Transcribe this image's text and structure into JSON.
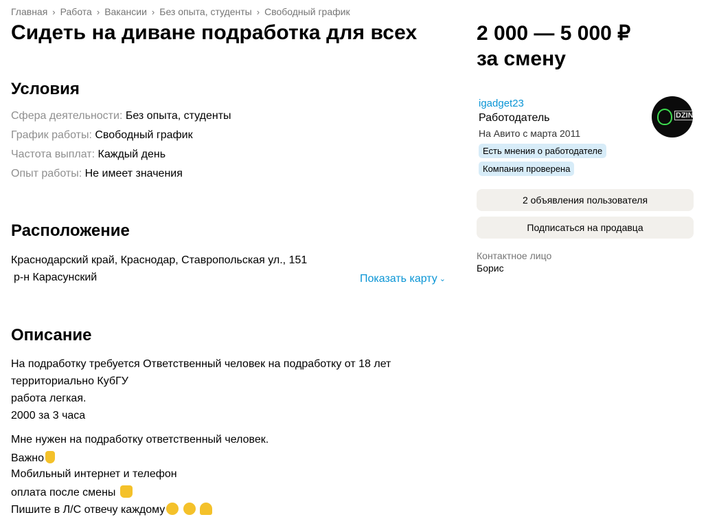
{
  "breadcrumbs": [
    "Главная",
    "Работа",
    "Вакансии",
    "Без опыта, студенты",
    "Свободный график"
  ],
  "title": "Сидеть на диване подработка для всех",
  "price": {
    "range": "2 000 — 5 000 ₽",
    "period": "за смену"
  },
  "conditions": {
    "heading": "Условия",
    "items": [
      {
        "label": "Сфера деятельности:",
        "value": "Без опыта, студенты"
      },
      {
        "label": "График работы:",
        "value": "Свободный график"
      },
      {
        "label": "Частота выплат:",
        "value": "Каждый день"
      },
      {
        "label": "Опыт работы:",
        "value": "Не имеет значения"
      }
    ]
  },
  "location": {
    "heading": "Расположение",
    "address": "Краснодарский край, Краснодар, Ставропольская ул., 151",
    "district": "р-н Карасунский",
    "show_map": "Показать карту"
  },
  "description": {
    "heading": "Описание",
    "lines": [
      "На подработку требуется Ответственный человек на подработку от 18 лет",
      "территориально КубГУ",
      "работа легкая.",
      "2000 за 3 часа",
      "Мне нужен на подработку ответственный человек.",
      "Важно",
      "Мобильный интернет и телефон",
      "оплата после смены",
      "Пишите в Л/С отвечу каждому"
    ]
  },
  "seller": {
    "name": "igadget23",
    "role": "Работодатель",
    "since": "На Авито с марта 2011",
    "badges": [
      "Есть мнения о работодателе",
      "Компания проверена"
    ],
    "avatar_text": "DZIN"
  },
  "buttons": {
    "ads": "2 объявления пользователя",
    "subscribe": "Подписаться на продавца"
  },
  "contact": {
    "label": "Контактное лицо",
    "name": "Борис"
  },
  "colors": {
    "link": "#0a95d5",
    "badge_bg": "#d7ecf8",
    "button_bg": "#f2f0ec",
    "muted": "#8f8f8f"
  }
}
